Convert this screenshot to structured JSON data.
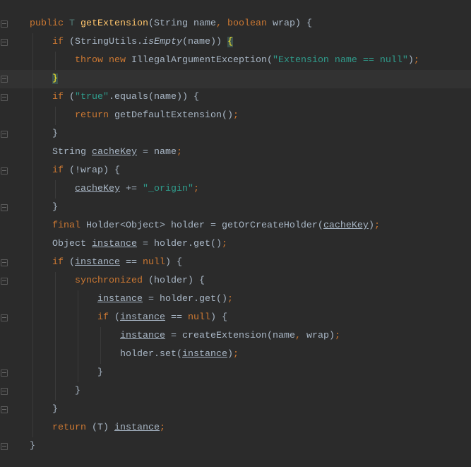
{
  "editor": {
    "theme_colors": {
      "background": "#2b2b2b",
      "keyword": "#cc7832",
      "method": "#ffc66d",
      "string": "#2f9c8c",
      "text": "#a9b7c6"
    },
    "current_line": 4,
    "lines": [
      {
        "indent": 0,
        "fold": true,
        "tokens": [
          [
            "public ",
            "kw"
          ],
          [
            "T ",
            "tp"
          ],
          [
            "getExtension",
            "fn"
          ],
          [
            "(String name",
            ""
          ],
          [
            ", ",
            "kw"
          ],
          [
            "boolean ",
            "kw"
          ],
          [
            "wrap) {",
            ""
          ]
        ]
      },
      {
        "indent": 1,
        "fold": true,
        "tokens": [
          [
            "if ",
            "kw"
          ],
          [
            "(StringUtils.",
            ""
          ],
          [
            "isEmpty",
            "it"
          ],
          [
            "(name)) ",
            ""
          ],
          [
            "{",
            "brace"
          ]
        ]
      },
      {
        "indent": 2,
        "fold": false,
        "tokens": [
          [
            "throw new ",
            "kw"
          ],
          [
            "IllegalArgumentException(",
            ""
          ],
          [
            "\"Extension name == null\"",
            "str"
          ],
          [
            ")",
            ""
          ],
          [
            ";",
            "kw"
          ]
        ]
      },
      {
        "indent": 1,
        "fold": true,
        "tokens": [
          [
            "}",
            "brace"
          ]
        ]
      },
      {
        "indent": 1,
        "fold": true,
        "tokens": [
          [
            "if ",
            "kw"
          ],
          [
            "(",
            ""
          ],
          [
            "\"true\"",
            "str"
          ],
          [
            ".equals(name)) {",
            ""
          ]
        ]
      },
      {
        "indent": 2,
        "fold": false,
        "tokens": [
          [
            "return ",
            "kw"
          ],
          [
            "getDefaultExtension()",
            ""
          ],
          [
            ";",
            "kw"
          ]
        ]
      },
      {
        "indent": 1,
        "fold": true,
        "tokens": [
          [
            "}",
            ""
          ]
        ]
      },
      {
        "indent": 1,
        "fold": false,
        "tokens": [
          [
            "String ",
            ""
          ],
          [
            "cacheKey",
            "ul"
          ],
          [
            " = name",
            ""
          ],
          [
            ";",
            "kw"
          ]
        ]
      },
      {
        "indent": 1,
        "fold": true,
        "tokens": [
          [
            "if ",
            "kw"
          ],
          [
            "(!wrap) {",
            ""
          ]
        ]
      },
      {
        "indent": 2,
        "fold": false,
        "tokens": [
          [
            "cacheKey",
            "ul"
          ],
          [
            " += ",
            ""
          ],
          [
            "\"_origin\"",
            "str"
          ],
          [
            ";",
            "kw"
          ]
        ]
      },
      {
        "indent": 1,
        "fold": true,
        "tokens": [
          [
            "}",
            ""
          ]
        ]
      },
      {
        "indent": 1,
        "fold": false,
        "tokens": [
          [
            "final ",
            "kw"
          ],
          [
            "Holder<Object> holder = getOrCreateHolder(",
            ""
          ],
          [
            "cacheKey",
            "ul"
          ],
          [
            ")",
            ""
          ],
          [
            ";",
            "kw"
          ]
        ]
      },
      {
        "indent": 1,
        "fold": false,
        "tokens": [
          [
            "Object ",
            ""
          ],
          [
            "instance",
            "ul"
          ],
          [
            " = holder.get()",
            ""
          ],
          [
            ";",
            "kw"
          ]
        ]
      },
      {
        "indent": 1,
        "fold": true,
        "tokens": [
          [
            "if ",
            "kw"
          ],
          [
            "(",
            ""
          ],
          [
            "instance",
            "ul"
          ],
          [
            " == ",
            ""
          ],
          [
            "null",
            "kw"
          ],
          [
            ") {",
            ""
          ]
        ]
      },
      {
        "indent": 2,
        "fold": true,
        "tokens": [
          [
            "synchronized ",
            "kw"
          ],
          [
            "(holder) {",
            ""
          ]
        ]
      },
      {
        "indent": 3,
        "fold": false,
        "tokens": [
          [
            "instance",
            "ul"
          ],
          [
            " = holder.get()",
            ""
          ],
          [
            ";",
            "kw"
          ]
        ]
      },
      {
        "indent": 3,
        "fold": true,
        "tokens": [
          [
            "if ",
            "kw"
          ],
          [
            "(",
            ""
          ],
          [
            "instance",
            "ul"
          ],
          [
            " == ",
            ""
          ],
          [
            "null",
            "kw"
          ],
          [
            ") {",
            ""
          ]
        ]
      },
      {
        "indent": 4,
        "fold": false,
        "tokens": [
          [
            "instance",
            "ul"
          ],
          [
            " = createExtension(name",
            ""
          ],
          [
            ", ",
            "kw"
          ],
          [
            "wrap)",
            ""
          ],
          [
            ";",
            "kw"
          ]
        ]
      },
      {
        "indent": 4,
        "fold": false,
        "tokens": [
          [
            "holder.set(",
            ""
          ],
          [
            "instance",
            "ul"
          ],
          [
            ")",
            ""
          ],
          [
            ";",
            "kw"
          ]
        ]
      },
      {
        "indent": 3,
        "fold": true,
        "tokens": [
          [
            "}",
            ""
          ]
        ]
      },
      {
        "indent": 2,
        "fold": true,
        "tokens": [
          [
            "}",
            ""
          ]
        ]
      },
      {
        "indent": 1,
        "fold": true,
        "tokens": [
          [
            "}",
            ""
          ]
        ]
      },
      {
        "indent": 1,
        "fold": false,
        "tokens": [
          [
            "return ",
            "kw"
          ],
          [
            "(T) ",
            ""
          ],
          [
            "instance",
            "ul"
          ],
          [
            ";",
            "kw"
          ]
        ]
      },
      {
        "indent": 0,
        "fold": true,
        "tokens": [
          [
            "}",
            ""
          ]
        ]
      }
    ]
  }
}
